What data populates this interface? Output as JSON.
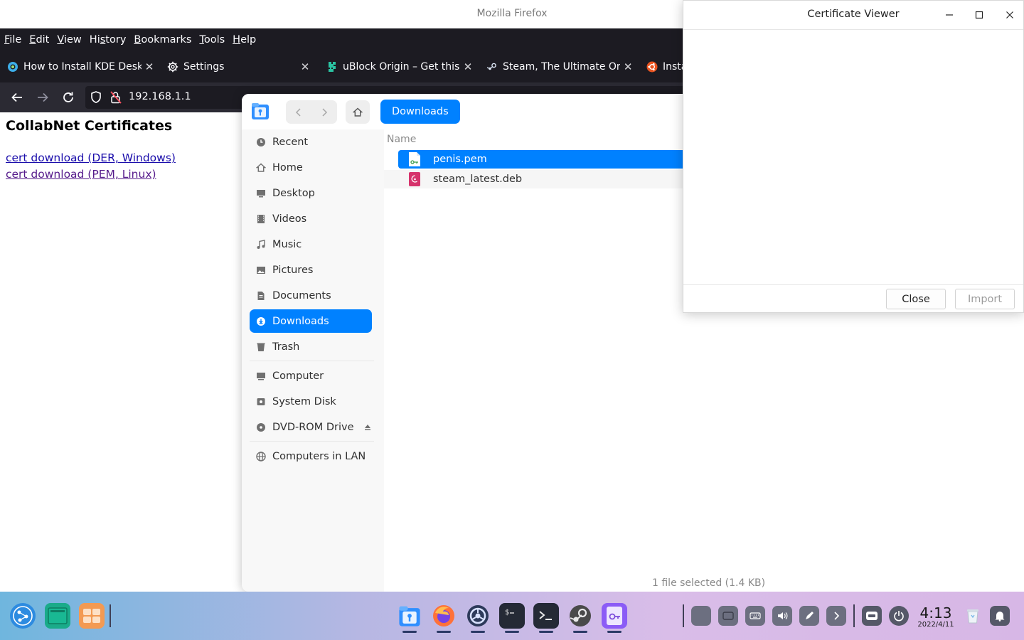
{
  "firefox": {
    "window_title": "Mozilla Firefox",
    "menu": [
      {
        "pre": "",
        "ul": "F",
        "post": "ile"
      },
      {
        "pre": "",
        "ul": "E",
        "post": "dit"
      },
      {
        "pre": "",
        "ul": "V",
        "post": "iew"
      },
      {
        "pre": "Hi",
        "ul": "s",
        "post": "tory"
      },
      {
        "pre": "",
        "ul": "B",
        "post": "ookmarks"
      },
      {
        "pre": "",
        "ul": "T",
        "post": "ools"
      },
      {
        "pre": "",
        "ul": "H",
        "post": "elp"
      }
    ],
    "tabs": [
      {
        "label": "How to Install KDE Deskto",
        "icon": "kde-site-icon"
      },
      {
        "label": "Settings",
        "icon": "gear-icon"
      },
      {
        "label": "uBlock Origin – Get this E",
        "icon": "addon-icon"
      },
      {
        "label": "Steam, The Ultimate Onlin",
        "icon": "steam-icon"
      },
      {
        "label": "Insta",
        "icon": "ubuntu-icon"
      }
    ],
    "url": "192.168.1.1",
    "page": {
      "heading": "CollabNet Certificates",
      "links": [
        "cert download (DER, Windows)",
        "cert download (PEM, Linux)"
      ]
    }
  },
  "file_dialog": {
    "breadcrumb": "Downloads",
    "sidebar": {
      "items": [
        "Recent",
        "Home",
        "Desktop",
        "Videos",
        "Music",
        "Pictures",
        "Documents",
        "Downloads",
        "Trash"
      ],
      "active": "Downloads",
      "devices": [
        "Computer",
        "System Disk",
        "DVD-ROM Drive"
      ],
      "network": [
        "Computers in LAN"
      ]
    },
    "column_header": "Name",
    "files": [
      {
        "name": "penis.pem",
        "selected": true,
        "icon": "certificate-file-icon"
      },
      {
        "name": "steam_latest.deb",
        "selected": false,
        "icon": "debian-package-icon"
      }
    ],
    "status": "1 file selected (1.4 KB)",
    "accent_color": "#0081ff"
  },
  "cert_viewer": {
    "title": "Certificate Viewer",
    "close_label": "Close",
    "import_label": "Import"
  },
  "taskbar": {
    "time": "4:13",
    "date": "2022/4/11"
  }
}
